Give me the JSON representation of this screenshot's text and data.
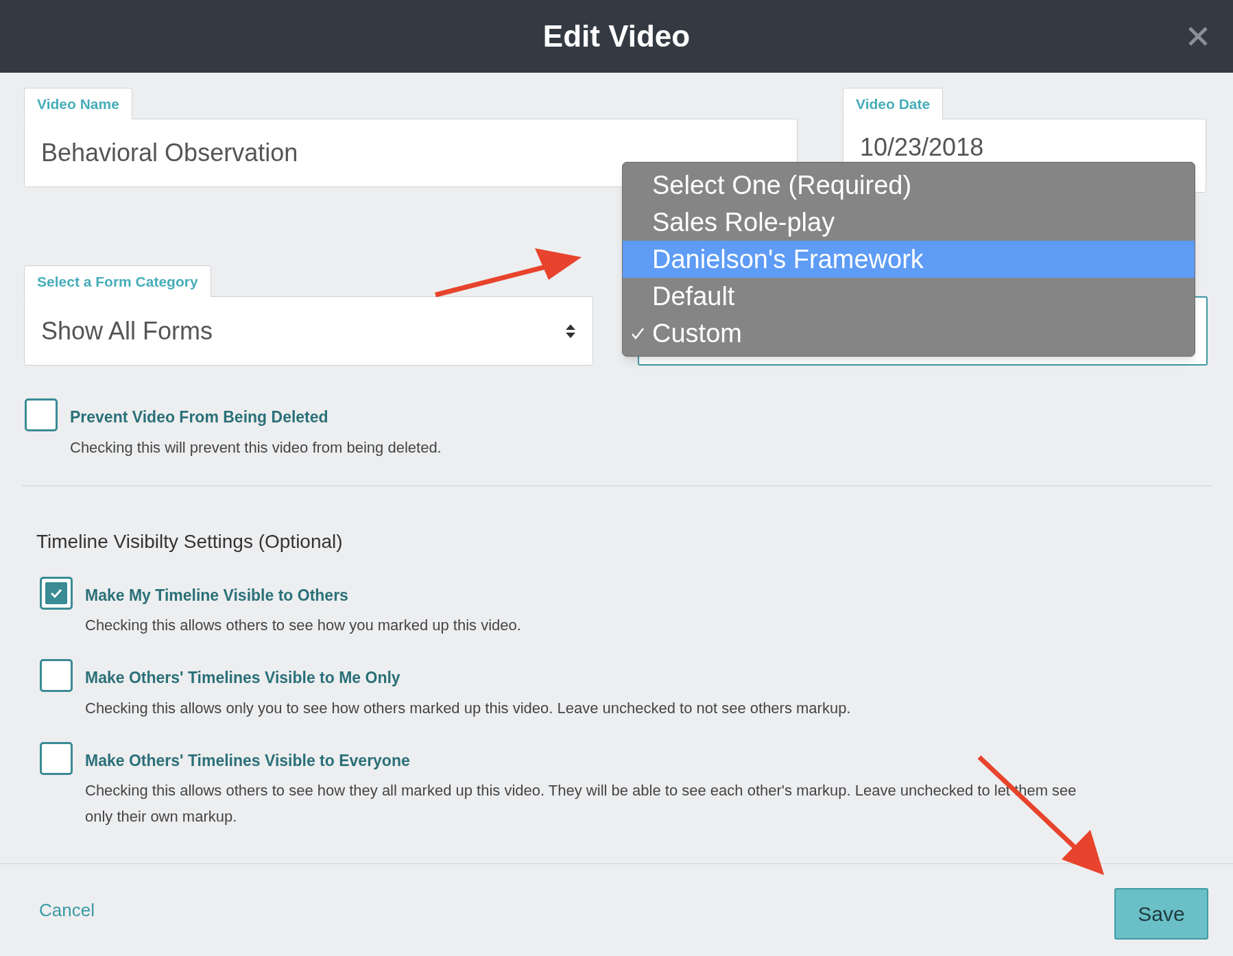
{
  "dialog": {
    "title": "Edit Video"
  },
  "video_name": {
    "label": "Video Name",
    "value": "Behavioral Observation"
  },
  "video_date": {
    "label": "Video Date",
    "value": "10/23/2018"
  },
  "form_category": {
    "label": "Select a Form Category",
    "value": "Show All Forms"
  },
  "form_menu": {
    "items": [
      {
        "label": "Select One (Required)",
        "selected": false,
        "checked": false
      },
      {
        "label": "Sales Role-play",
        "selected": false,
        "checked": false
      },
      {
        "label": "Danielson's Framework",
        "selected": true,
        "checked": false
      },
      {
        "label": "Default",
        "selected": false,
        "checked": false
      },
      {
        "label": "Custom",
        "selected": false,
        "checked": true
      }
    ]
  },
  "protect": {
    "label": "Prevent Video From Being Deleted",
    "description": "Checking this will prevent this video from being deleted.",
    "checked": false
  },
  "timeline": {
    "heading": "Timeline Visibilty Settings (Optional)",
    "options": [
      {
        "label": "Make My Timeline Visible to Others",
        "description": "Checking this allows others to see how you marked up this video.",
        "checked": true
      },
      {
        "label": "Make Others' Timelines Visible to Me Only",
        "description": "Checking this allows only you to see how others marked up this video. Leave unchecked to not see others markup.",
        "checked": false
      },
      {
        "label": "Make Others' Timelines Visible to Everyone",
        "description": "Checking this allows others to see how they all marked up this video. They will be able to see each other's markup. Leave unchecked to let them see only their own markup.",
        "checked": false
      }
    ]
  },
  "footer": {
    "cancel": "Cancel",
    "save": "Save"
  }
}
